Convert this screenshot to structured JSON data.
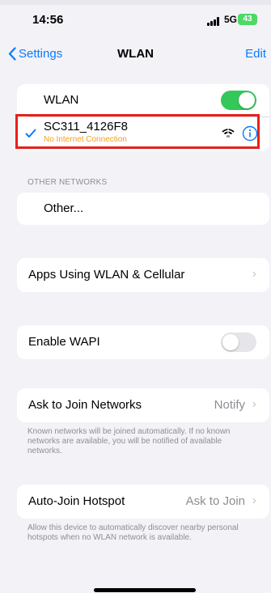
{
  "status_bar": {
    "time": "14:56",
    "network": "5G",
    "battery": "43"
  },
  "nav": {
    "back_label": "Settings",
    "title": "WLAN",
    "edit_label": "Edit"
  },
  "wlan_toggle": {
    "label": "WLAN",
    "state": "on"
  },
  "connected_network": {
    "name": "SC311_4126F8",
    "status": "No Internet Connection",
    "status_color": "#f0a020"
  },
  "other_networks": {
    "header": "OTHER NETWORKS",
    "other_label": "Other..."
  },
  "apps_using": {
    "label": "Apps Using WLAN & Cellular"
  },
  "enable_wapi": {
    "label": "Enable WAPI",
    "state": "off"
  },
  "ask_to_join": {
    "label": "Ask to Join Networks",
    "value": "Notify",
    "footnote": "Known networks will be joined automatically. If no known networks are available, you will be notified of available networks."
  },
  "auto_join_hotspot": {
    "label": "Auto-Join Hotspot",
    "value": "Ask to Join",
    "footnote": "Allow this device to automatically discover nearby personal hotspots when no WLAN network is available."
  },
  "colors": {
    "accent": "#0a7aff",
    "toggle_on": "#34c759",
    "highlight": "#e8201a"
  }
}
